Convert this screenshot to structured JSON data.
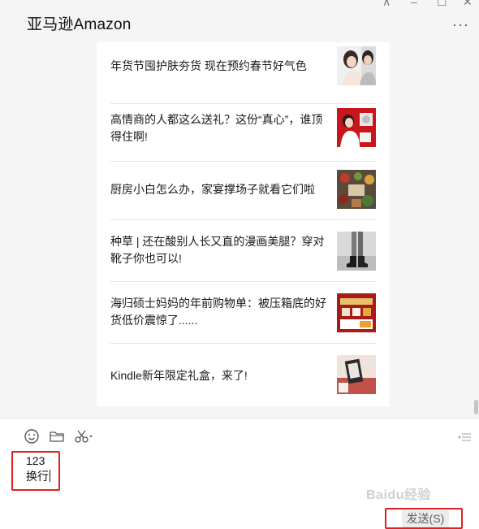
{
  "header": {
    "title": "亚马逊Amazon",
    "pin_glyph": "⊼",
    "minimize_glyph": "–",
    "maximize_glyph": "☐",
    "close_glyph": "✕",
    "more_glyph": "···"
  },
  "articles": [
    {
      "title": "年货节囤护肤夯货 现在预约春节好气色",
      "thumb": "woman-skincare"
    },
    {
      "title": "高情商的人都这么送礼？这份“真心”，谁顶得住啊!",
      "thumb": "woman-gift"
    },
    {
      "title": "厨房小白怎么办，家宴撑场子就看它们啦",
      "thumb": "kitchen-ingredients"
    },
    {
      "title": "种草 | 还在酸别人长又直的漫画美腿？穿对靴子你也可以!",
      "thumb": "boots-legs"
    },
    {
      "title": "海归硕士妈妈的年前购物单：被压箱底的好货低价震惊了......",
      "thumb": "shopping-banner"
    },
    {
      "title": "Kindle新年限定礼盒，来了!",
      "thumb": "kindle-box"
    }
  ],
  "input": {
    "lines": [
      "123",
      "换行"
    ],
    "send_label": "发送(S)",
    "watermark": "Baidu经验"
  },
  "colors": {
    "highlight": "#e02020",
    "background": "#f5f5f5",
    "card": "#ffffff"
  },
  "icons": [
    "emoji-icon",
    "folder-icon",
    "scissors-icon",
    "chevron-down-icon",
    "collapse-icon"
  ]
}
